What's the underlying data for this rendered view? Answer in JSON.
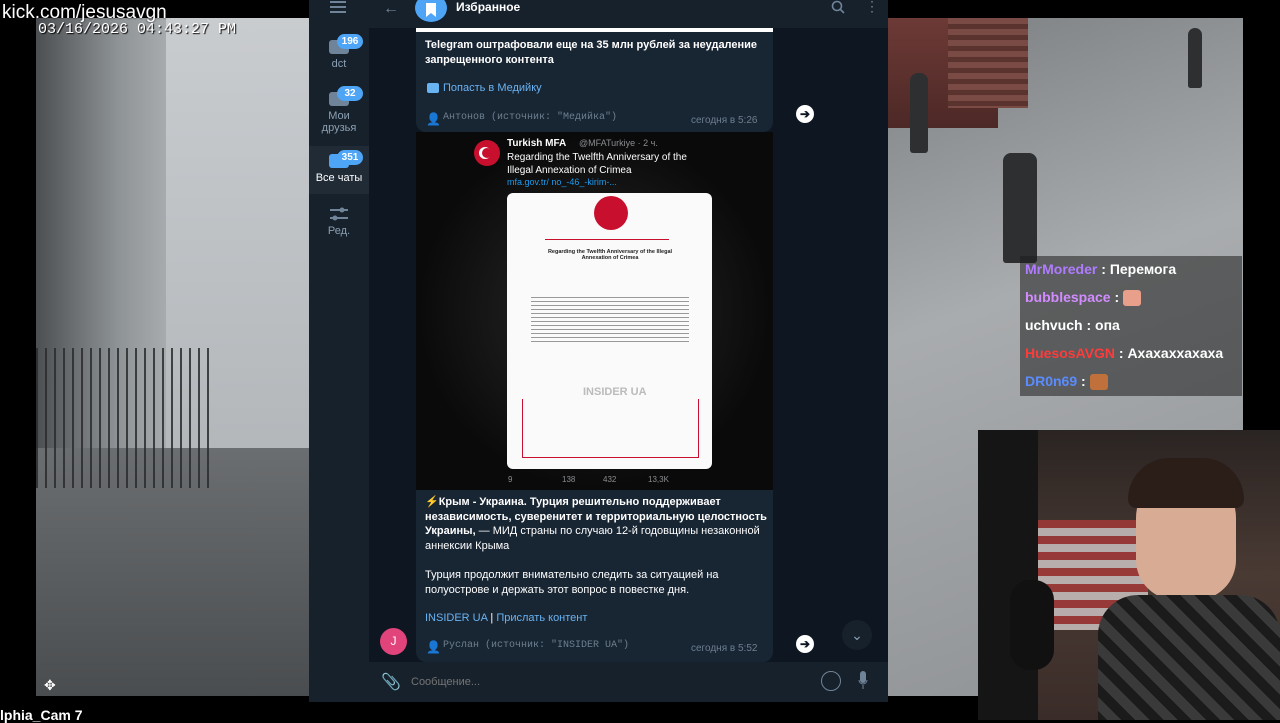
{
  "stream": {
    "url": "kick.com/jesusavgn",
    "camera_timestamp": "03/16/2026 04:43:27 PM",
    "camera_name": "lphia_Cam 7"
  },
  "telegram": {
    "folders": [
      {
        "label": "dct",
        "badge": "196"
      },
      {
        "label": "Мои друзья",
        "badge": "32"
      },
      {
        "label": "Все чаты",
        "badge": "351"
      },
      {
        "label": "Ред.",
        "badge": ""
      }
    ],
    "header": {
      "title": "Избранное"
    },
    "message1": {
      "text": "Telegram оштрафовали еще на 35 млн рублей за неудаление запрещенного контента",
      "link": "Попасть в Медийку",
      "source": "Антонов (источник: \"Медийка\")",
      "time": "сегодня в 5:26"
    },
    "tweet": {
      "author": "Turkish MFA",
      "handle": "@MFATurkiye · 2 ч.",
      "text": "Regarding the Twelfth Anniversary of the Illegal Annexation of Crimea",
      "link": "mfa.gov.tr/ no_-46_-kirim-...",
      "doc_title": "Regarding the Twelfth Anniversary of the Illegal Annexation of Crimea",
      "watermark": "INSIDER UA",
      "stats": [
        "9",
        "138",
        "432",
        "13,3K"
      ]
    },
    "message2": {
      "bold": "⚡Крым - Украина. Турция решительно поддерживает независимость, суверенитет и территориальную целостность Украины,",
      "text": " — МИД страны по случаю 12-й годовщины незаконной аннексии Крыма",
      "paragraph2": "Турция продолжит внимательно следить за ситуацией на полуострове и держать этот вопрос в повестке дня.",
      "link1": "INSIDER UA",
      "separator": "|",
      "link2": "Прислать контент",
      "source": "Руслан (источник: \"INSIDER UA\")",
      "time": "сегодня в 5:52",
      "avatar_letter": "J"
    },
    "input": {
      "placeholder": "Сообщение..."
    }
  },
  "chat_overlay": [
    {
      "user": "MrMoreder",
      "message": "Перемога",
      "color": "#b07cff"
    },
    {
      "user": "bubblespace",
      "message": "",
      "color": "#d28cff"
    },
    {
      "user": "uchvuch",
      "message": "опа",
      "color": "#ffffff"
    },
    {
      "user": "HuesosAVGN",
      "message": "Ахахаххахаха",
      "color": "#ff3b3b"
    },
    {
      "user": "DR0n69",
      "message": "",
      "color": "#5a8cff"
    }
  ],
  "colors": {
    "accent": "#4ea4f5",
    "link": "#6ab3f3",
    "bg": "#0e1621",
    "panel": "#17212b"
  }
}
